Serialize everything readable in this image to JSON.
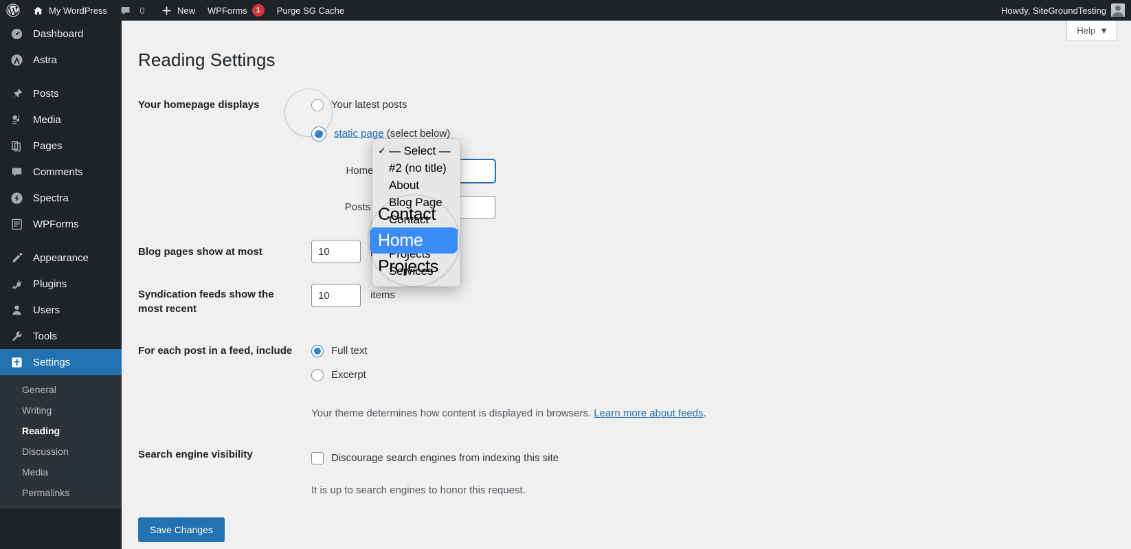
{
  "adminbar": {
    "wp_logo": "wordpress-logo",
    "site_name": "My WordPress",
    "comments_count": "0",
    "new_label": "New",
    "wpforms_label": "WPForms",
    "wpforms_count": "1",
    "purge_label": "Purge SG Cache",
    "howdy": "Howdy, SiteGroundTesting"
  },
  "sidebar": {
    "items": [
      {
        "label": "Dashboard",
        "icon": "dashboard-icon"
      },
      {
        "label": "Astra",
        "icon": "astra-icon"
      },
      {
        "label": "Posts",
        "icon": "pin-icon"
      },
      {
        "label": "Media",
        "icon": "media-icon"
      },
      {
        "label": "Pages",
        "icon": "pages-icon"
      },
      {
        "label": "Comments",
        "icon": "comment-icon"
      },
      {
        "label": "Spectra",
        "icon": "spectra-icon"
      },
      {
        "label": "WPForms",
        "icon": "wpforms-icon"
      },
      {
        "label": "Appearance",
        "icon": "appearance-icon"
      },
      {
        "label": "Plugins",
        "icon": "plugins-icon"
      },
      {
        "label": "Users",
        "icon": "users-icon"
      },
      {
        "label": "Tools",
        "icon": "tools-icon"
      },
      {
        "label": "Settings",
        "icon": "settings-icon"
      }
    ],
    "submenu": [
      {
        "label": "General"
      },
      {
        "label": "Writing"
      },
      {
        "label": "Reading"
      },
      {
        "label": "Discussion"
      },
      {
        "label": "Media"
      },
      {
        "label": "Permalinks"
      }
    ],
    "active_item": "Settings",
    "active_subitem": "Reading"
  },
  "screen_meta": {
    "help_label": "Help",
    "help_caret": "▼"
  },
  "page": {
    "title": "Reading Settings"
  },
  "settings": {
    "homepage_displays": {
      "label": "Your homepage displays",
      "option_latest": "Your latest posts",
      "option_static_link": "static page",
      "option_static_suffix": "(select below)",
      "selected": "static page"
    },
    "homepage_row": {
      "label": "Homepage:",
      "value": "— Select —"
    },
    "posts_page_row": {
      "label": "Posts page:",
      "value": "— Select —"
    },
    "blog_pages": {
      "label": "Blog pages show at most",
      "value": "10",
      "units": "posts"
    },
    "syndication": {
      "label": "Syndication feeds show the most recent",
      "value": "10",
      "units": "items"
    },
    "feed_include": {
      "label": "For each post in a feed, include",
      "option_full": "Full text",
      "option_excerpt": "Excerpt",
      "selected": "Full text",
      "description_text": "Your theme determines how content is displayed in browsers. ",
      "description_link": "Learn more about feeds",
      "description_tail": "."
    },
    "search_visibility": {
      "label": "Search engine visibility",
      "checkbox_label": "Discourage search engines from indexing this site",
      "checked": false,
      "note": "It is up to search engines to honor this request."
    },
    "save_label": "Save Changes"
  },
  "select_popup": {
    "options": [
      {
        "label": "— Select —",
        "checked": true
      },
      {
        "label": "#2 (no title)",
        "checked": false
      },
      {
        "label": "About",
        "checked": false
      },
      {
        "label": "Blog Page",
        "checked": false
      },
      {
        "label": "Contact",
        "checked": false
      },
      {
        "label": "Home",
        "checked": false,
        "highlighted": true
      },
      {
        "label": "Projects",
        "checked": false
      },
      {
        "label": "Services",
        "checked": false
      }
    ],
    "highlighted": "Home",
    "checkmark": "✓"
  },
  "loupe": {
    "rows": [
      "Contact",
      "Home",
      "Projects"
    ],
    "highlighted": "Home"
  },
  "colors": {
    "admin_blue": "#2271b1",
    "sidebar_bg": "#1d2327",
    "submenu_bg": "#2c3338",
    "content_bg": "#f0f0f1",
    "mac_highlight": "#3b8cf7",
    "badge_red": "#d63638"
  }
}
